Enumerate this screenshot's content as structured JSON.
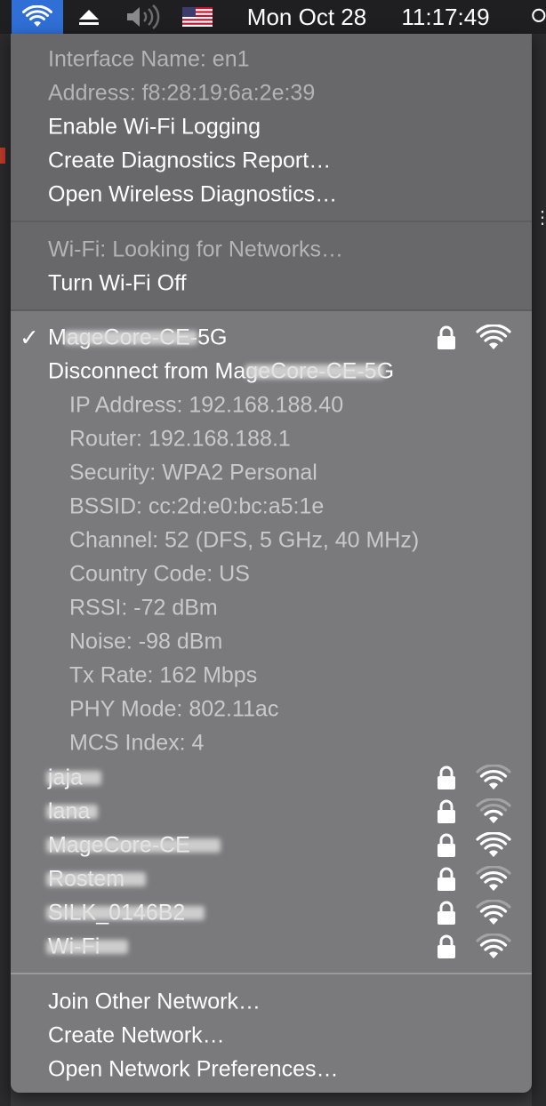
{
  "menubar": {
    "wifi_icon": "wifi-icon",
    "eject_icon": "eject-icon",
    "volume_icon": "speaker-muted-icon",
    "flag_icon": "us-flag-icon",
    "date": "Mon Oct 28",
    "time": "11:17:49"
  },
  "menu": {
    "info": {
      "interface": "Interface Name: en1",
      "address": "Address: f8:28:19:6a:2e:39"
    },
    "actions": [
      "Enable Wi-Fi Logging",
      "Create Diagnostics Report…",
      "Open Wireless Diagnostics…"
    ],
    "status": "Wi-Fi: Looking for Networks…",
    "toggle": "Turn Wi-Fi Off",
    "connected": {
      "name": "MageCore-CE-5G",
      "disconnect": "Disconnect from MageCore-CE-5G",
      "details": [
        "IP Address: 192.168.188.40",
        "Router: 192.168.188.1",
        "Security: WPA2 Personal",
        "BSSID: cc:2d:e0:bc:a5:1e",
        "Channel: 52 (DFS, 5 GHz, 40 MHz)",
        "Country Code: US",
        "RSSI: -72 dBm",
        "Noise: -98 dBm",
        "Tx Rate: 162 Mbps",
        "PHY Mode: 802.11ac",
        "MCS Index: 4"
      ]
    },
    "networks": [
      {
        "name": "jaja",
        "signal": 2
      },
      {
        "name": "lana",
        "signal": 1
      },
      {
        "name": "MageCore-CE",
        "signal": 3
      },
      {
        "name": "Rostem",
        "signal": 2
      },
      {
        "name": "SILK_0146B2",
        "signal": 2
      },
      {
        "name": "Wi-Fi",
        "signal": 2
      }
    ],
    "footer": [
      "Join Other Network…",
      "Create Network…",
      "Open Network Preferences…"
    ]
  }
}
